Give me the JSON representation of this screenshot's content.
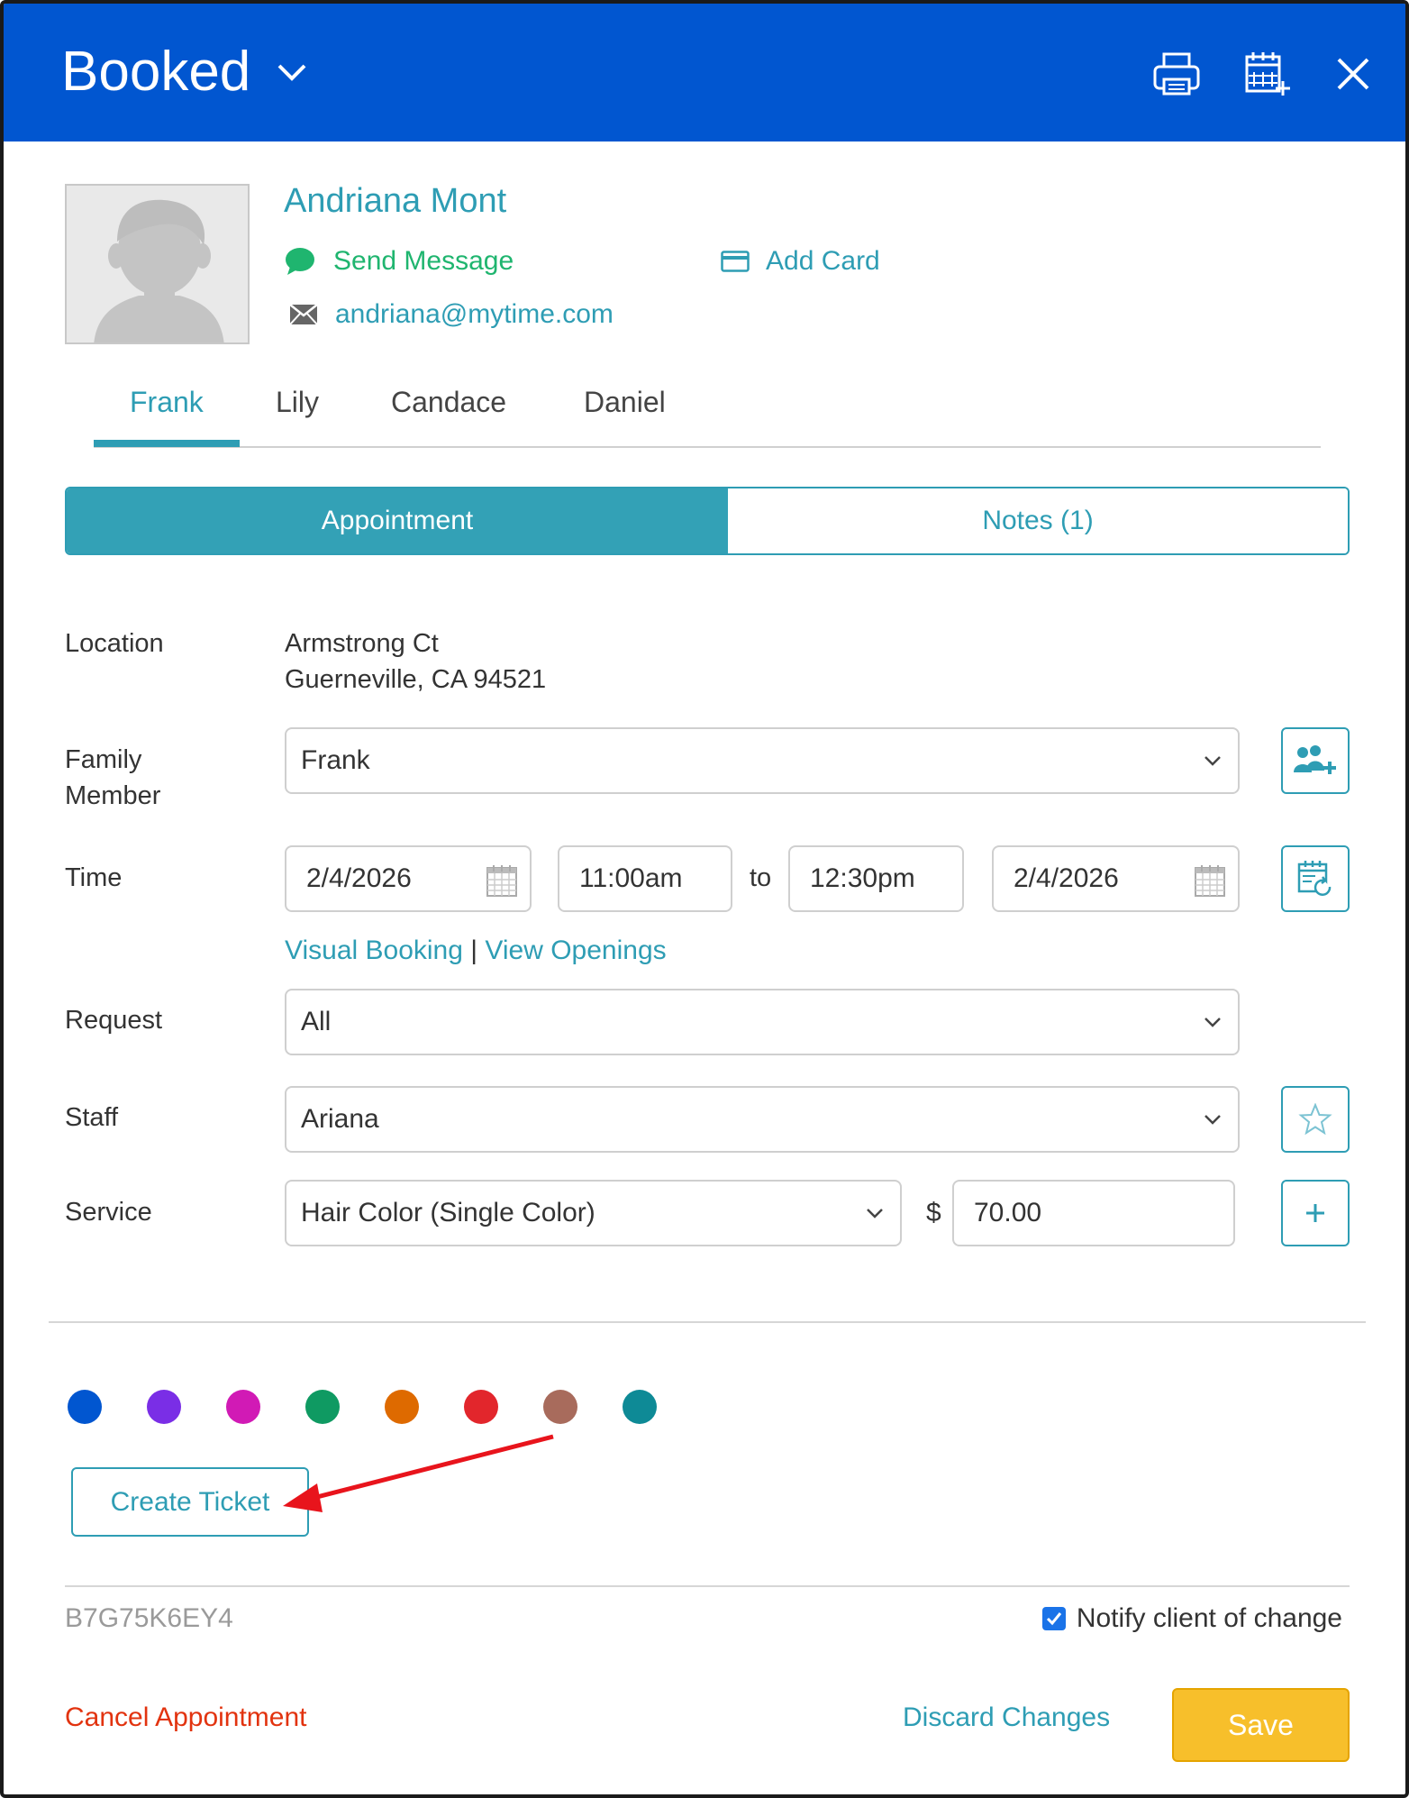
{
  "header": {
    "title": "Booked",
    "icons": [
      "chevron-down-icon",
      "printer-icon",
      "calendar-add-icon",
      "close-icon"
    ]
  },
  "client": {
    "name": "Andriana Mont",
    "send_message": "Send Message",
    "add_card": "Add Card",
    "email": "andriana@mytime.com"
  },
  "family_tabs": [
    {
      "label": "Frank",
      "active": true
    },
    {
      "label": "Lily",
      "active": false
    },
    {
      "label": "Candace",
      "active": false
    },
    {
      "label": "Daniel",
      "active": false
    }
  ],
  "segments": {
    "appointment": "Appointment",
    "notes": "Notes (1)"
  },
  "form": {
    "location_label": "Location",
    "location_line1": "Armstrong Ct",
    "location_line2": "Guerneville, CA 94521",
    "family_label_1": "Family",
    "family_label_2": "Member",
    "family_value": "Frank",
    "time_label": "Time",
    "start_date": "2/4/2026",
    "start_time": "11:00am",
    "to": "to",
    "end_time": "12:30pm",
    "end_date": "2/4/2026",
    "visual_booking": "Visual Booking",
    "pipe": "|",
    "view_openings": "View Openings",
    "request_label": "Request",
    "request_value": "All",
    "staff_label": "Staff",
    "staff_value": "Ariana",
    "service_label": "Service",
    "service_value": "Hair Color (Single Color)",
    "currency": "$",
    "price": "70.00"
  },
  "color_tags": [
    "#0156d0",
    "#7a2ee6",
    "#d11ab5",
    "#0f9a62",
    "#de6a00",
    "#e2262c",
    "#a86b5c",
    "#0e8a96"
  ],
  "actions": {
    "create_ticket": "Create Ticket",
    "booking_code": "B7G75K6EY4",
    "notify_label": "Notify client of change",
    "notify_checked": true,
    "cancel": "Cancel Appointment",
    "discard": "Discard Changes",
    "save": "Save"
  },
  "annotation": {
    "arrow_color": "#e8141c"
  }
}
